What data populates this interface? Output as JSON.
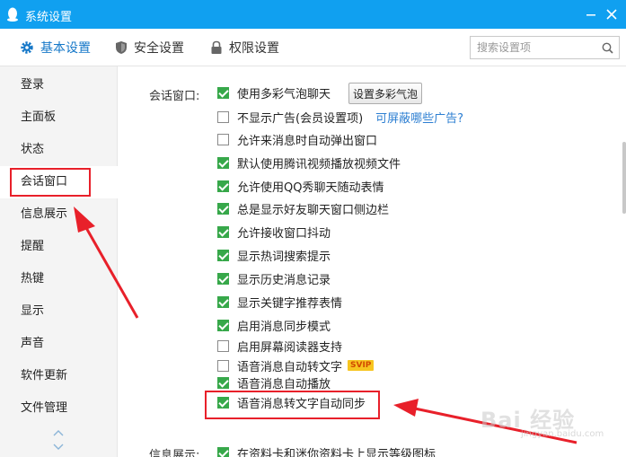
{
  "window": {
    "title": "系统设置"
  },
  "tabs": [
    {
      "label": "基本设置",
      "icon": "gear-icon",
      "active": true
    },
    {
      "label": "安全设置",
      "icon": "shield-icon",
      "active": false
    },
    {
      "label": "权限设置",
      "icon": "lock-icon",
      "active": false
    }
  ],
  "search": {
    "placeholder": "搜索设置项"
  },
  "sidebar": {
    "items": [
      {
        "label": "登录"
      },
      {
        "label": "主面板"
      },
      {
        "label": "状态"
      },
      {
        "label": "会话窗口",
        "active": true
      },
      {
        "label": "信息展示"
      },
      {
        "label": "提醒"
      },
      {
        "label": "热键"
      },
      {
        "label": "显示"
      },
      {
        "label": "声音"
      },
      {
        "label": "软件更新"
      },
      {
        "label": "文件管理"
      }
    ]
  },
  "session_window": {
    "section_label": "会话窗口:",
    "bubble_button": "设置多彩气泡",
    "options": [
      {
        "label": "使用多彩气泡聊天",
        "checked": true
      },
      {
        "label": "不显示广告(会员设置项)",
        "checked": false,
        "link": "可屏蔽哪些广告?"
      },
      {
        "label": "允许来消息时自动弹出窗口",
        "checked": false
      },
      {
        "label": "默认使用腾讯视频播放视频文件",
        "checked": true
      },
      {
        "label": "允许使用QQ秀聊天随动表情",
        "checked": true
      },
      {
        "label": "总是显示好友聊天窗口侧边栏",
        "checked": true
      },
      {
        "label": "允许接收窗口抖动",
        "checked": true
      },
      {
        "label": "显示热词搜索提示",
        "checked": true
      },
      {
        "label": "显示历史消息记录",
        "checked": true
      },
      {
        "label": "显示关键字推荐表情",
        "checked": true
      },
      {
        "label": "启用消息同步模式",
        "checked": true
      },
      {
        "label": "启用屏幕阅读器支持",
        "checked": false
      },
      {
        "label": "语音消息自动转文字",
        "checked": false,
        "badge": "SVIP"
      },
      {
        "label": "语音消息自动播放",
        "checked": true
      },
      {
        "label": "语音消息转文字自动同步",
        "checked": true
      }
    ]
  },
  "info_display": {
    "section_label": "信息展示:",
    "options": [
      {
        "label": "在资料卡和迷你资料卡上显示等级图标",
        "checked": true
      }
    ]
  },
  "watermark": {
    "text": "Bai 经验",
    "sub": "jingyan.baidu.com"
  },
  "colors": {
    "titlebar": "#10a0f0",
    "accent": "#1678c8",
    "checkbox_on": "#37a84a",
    "annotation": "#e8202a",
    "link": "#2d7fd2"
  }
}
